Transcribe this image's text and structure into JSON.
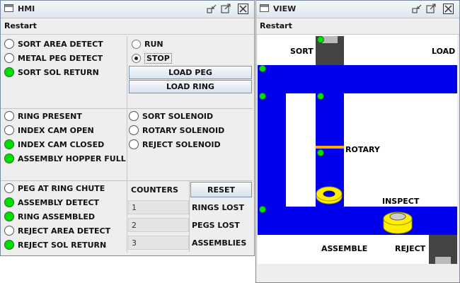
{
  "hmi": {
    "title": "HMI",
    "menu": "Restart",
    "sensors_a": [
      {
        "label": "SORT AREA DETECT",
        "on": false
      },
      {
        "label": "METAL PEG DETECT",
        "on": false
      },
      {
        "label": "SORT SOL RETURN",
        "on": true
      }
    ],
    "mode": {
      "run": "RUN",
      "stop": "STOP",
      "selected": "stop"
    },
    "buttons": {
      "load_peg": "LOAD PEG",
      "load_ring": "LOAD RING",
      "reset": "RESET"
    },
    "sensors_b": [
      {
        "label": "RING PRESENT",
        "on": false
      },
      {
        "label": "INDEX CAM OPEN",
        "on": false
      },
      {
        "label": "INDEX CAM CLOSED",
        "on": true
      },
      {
        "label": "ASSEMBLY HOPPER FULL",
        "on": true
      }
    ],
    "solenoids": [
      {
        "label": "SORT SOLENOID"
      },
      {
        "label": "ROTARY SOLENOID"
      },
      {
        "label": "REJECT SOLENOID"
      }
    ],
    "sensors_c": [
      {
        "label": "PEG AT RING CHUTE",
        "on": false
      },
      {
        "label": "ASSEMBLY DETECT",
        "on": true
      },
      {
        "label": "RING ASSEMBLED",
        "on": true
      },
      {
        "label": "REJECT AREA DETECT",
        "on": false
      },
      {
        "label": "REJECT SOL RETURN",
        "on": true
      }
    ],
    "counters": {
      "header": "COUNTERS",
      "rows": [
        {
          "value": "1",
          "label": "RINGS LOST"
        },
        {
          "value": "2",
          "label": "PEGS LOST"
        },
        {
          "value": "3",
          "label": "ASSEMBLIES"
        }
      ]
    }
  },
  "view": {
    "title": "VIEW",
    "menu": "Restart",
    "labels": {
      "sort": "SORT",
      "load": "LOAD",
      "rotary": "ROTARY",
      "inspect": "INSPECT",
      "assemble": "ASSEMBLE",
      "reject": "REJECT"
    },
    "colors": {
      "conveyor": "#0000ee",
      "sensor_on": "#00e000",
      "ring": "#ffee00",
      "rotary_bar": "#ffaa00"
    }
  }
}
